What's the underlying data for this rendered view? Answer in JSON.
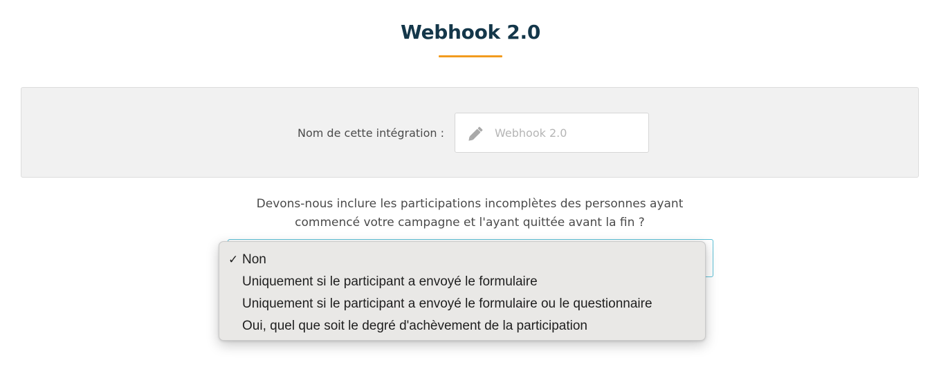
{
  "page": {
    "title": "Webhook 2.0"
  },
  "name_field": {
    "label": "Nom de cette intégration :",
    "value": "Webhook 2.0",
    "icon": "pencil-icon"
  },
  "question": {
    "line1": "Devons-nous inclure les participations incomplètes des personnes ayant",
    "line2": "commencé votre campagne et l'ayant quittée avant la fin ?"
  },
  "dropdown": {
    "selected_index": 0,
    "check_glyph": "✓",
    "options": [
      "Non",
      "Uniquement si le participant a envoyé le formulaire",
      "Uniquement si le participant a envoyé le formulaire ou le questionnaire",
      "Oui, quel que soit le degré d'achèvement de la participation"
    ]
  },
  "colors": {
    "title": "#14374a",
    "accent": "#f29b1e",
    "select_border": "#5bbfd6",
    "panel_background": "#f1f1f1"
  }
}
